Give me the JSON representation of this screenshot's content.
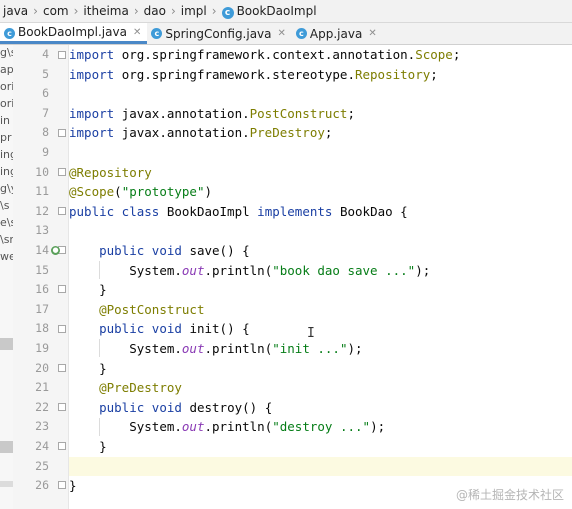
{
  "breadcrumb": [
    "java",
    "com",
    "itheima",
    "dao",
    "impl",
    "BookDaoImpl"
  ],
  "tabs": [
    {
      "label": "BookDaoImpl.java",
      "active": true
    },
    {
      "label": "SpringConfig.java",
      "active": false
    },
    {
      "label": "App.java",
      "active": false
    }
  ],
  "project_panel_fragments": [
    "g\\s",
    "ap",
    "ori",
    "ori",
    "in",
    "pr",
    "ing",
    "ing",
    "g\\y",
    "\\s",
    "e\\s",
    "\\sr",
    "we"
  ],
  "gutter": {
    "line_numbers": [
      "4",
      "5",
      "6",
      "7",
      "8",
      "9",
      "10",
      "11",
      "12",
      "13",
      "14",
      "15",
      "16",
      "17",
      "18",
      "19",
      "20",
      "21",
      "22",
      "23",
      "24",
      "25",
      "26"
    ],
    "bean_marker_line": "14"
  },
  "code": {
    "line4": {
      "kw": "import",
      "pkg": "org.springframework.context.annotation.",
      "cls": "Scope",
      "end": ";"
    },
    "line5": {
      "kw": "import",
      "pkg": "org.springframework.stereotype.",
      "cls": "Repository",
      "end": ";"
    },
    "line7": {
      "kw": "import",
      "pkg": "javax.annotation.",
      "cls": "PostConstruct",
      "end": ";"
    },
    "line8": {
      "kw": "import",
      "pkg": "javax.annotation.",
      "cls": "PreDestroy",
      "end": ";"
    },
    "line10": {
      "ann": "@Repository"
    },
    "line11": {
      "ann": "@Scope",
      "open": "(",
      "str": "\"prototype\"",
      "close": ")"
    },
    "line12": {
      "kw1": "public class",
      "name": "BookDaoImpl",
      "kw2": "implements",
      "iface": "BookDao {"
    },
    "line14": {
      "kw": "public void",
      "sig": "save() {"
    },
    "line15": {
      "obj": "System.",
      "fld": "out",
      "call": ".println(",
      "str": "\"book dao save ...\"",
      "end": ");"
    },
    "line16": {
      "brace": "}"
    },
    "line17": {
      "ann": "@PostConstruct"
    },
    "line18": {
      "kw": "public void",
      "sig": "init() {"
    },
    "line19": {
      "obj": "System.",
      "fld": "out",
      "call": ".println(",
      "str": "\"init ...\"",
      "end": ");"
    },
    "line20": {
      "brace": "}"
    },
    "line21": {
      "ann": "@PreDestroy"
    },
    "line22": {
      "kw": "public void",
      "sig": "destroy() {"
    },
    "line23": {
      "obj": "System.",
      "fld": "out",
      "call": ".println(",
      "str": "\"destroy ...\"",
      "end": ");"
    },
    "line24": {
      "brace": "}"
    },
    "line26": {
      "brace": "}"
    }
  },
  "watermark": "@稀土掘金技术社区",
  "colors": {
    "keyword": "#1a3fa3",
    "annotation": "#7d7d00",
    "string": "#067d17",
    "field": "#8a3bb5",
    "current_line": "#fcfae1"
  }
}
